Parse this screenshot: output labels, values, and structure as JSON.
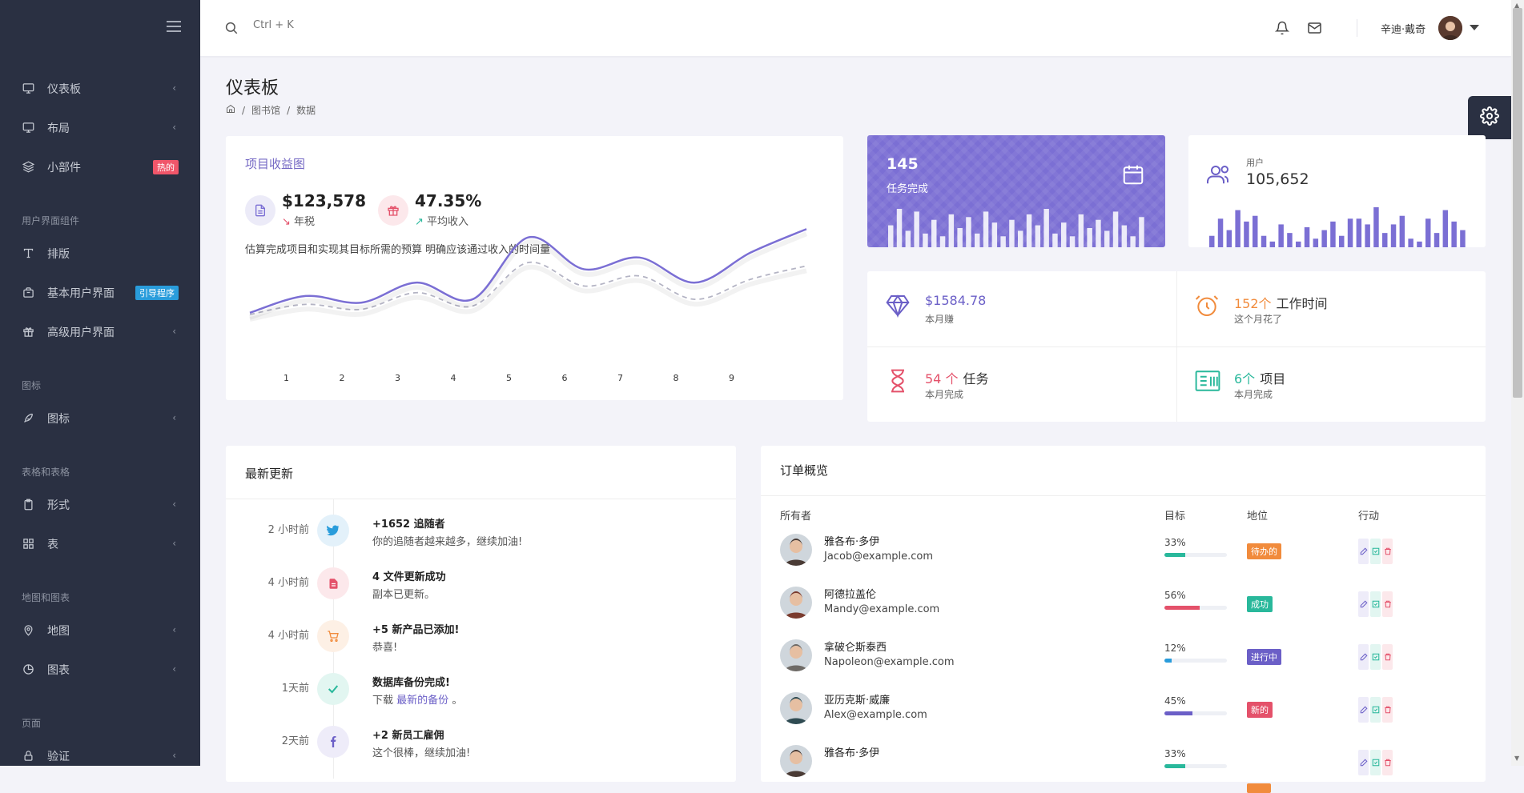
{
  "search": {
    "placeholder": "Ctrl + K"
  },
  "user": {
    "name": "辛迪·戴奇"
  },
  "sidebar": {
    "items": [
      {
        "label": "仪表板",
        "icon": "monitor-icon"
      },
      {
        "label": "布局",
        "icon": "monitor-icon"
      },
      {
        "label": "小部件",
        "icon": "layers-icon",
        "badge": "热的",
        "badge_color": "#f0566a"
      }
    ],
    "sections": [
      {
        "title": "用户界面组件",
        "items": [
          {
            "label": "排版",
            "icon": "type-icon"
          },
          {
            "label": "基本用户界面",
            "icon": "briefcase-icon",
            "badge": "引导程序",
            "badge_color": "#299cdb"
          },
          {
            "label": "高级用户界面",
            "icon": "gift-icon"
          }
        ]
      },
      {
        "title": "图标",
        "items": [
          {
            "label": "图标",
            "icon": "feather-icon"
          }
        ]
      },
      {
        "title": "表格和表格",
        "items": [
          {
            "label": "形式",
            "icon": "clipboard-icon"
          },
          {
            "label": "表",
            "icon": "grid-icon"
          }
        ]
      },
      {
        "title": "地图和图表",
        "items": [
          {
            "label": "地图",
            "icon": "map-pin-icon"
          },
          {
            "label": "图表",
            "icon": "pie-chart-icon"
          }
        ]
      },
      {
        "title": "页面",
        "items": [
          {
            "label": "验证",
            "icon": "lock-icon"
          }
        ]
      }
    ]
  },
  "page": {
    "title": "仪表板",
    "breadcrumb": [
      "图书馆",
      "数据"
    ]
  },
  "project": {
    "title": "项目收益图",
    "stat1": {
      "value": "$123,578",
      "label": "年税"
    },
    "stat2": {
      "value": "47.35%",
      "label": "平均收入"
    },
    "desc": "估算完成项目和实现其目标所需的预算 明确应该通过收入的时间量"
  },
  "chart_data": {
    "type": "line",
    "x": [
      0,
      1,
      2,
      3,
      4,
      5,
      6,
      7,
      8,
      9,
      10
    ],
    "tick_labels": [
      "1",
      "2",
      "3",
      "4",
      "5",
      "6",
      "7",
      "8",
      "9"
    ],
    "series": [
      {
        "values": [
          2,
          12,
          8,
          20,
          10,
          47,
          28,
          35,
          20,
          38,
          52
        ],
        "color": "#7b6fd4"
      },
      {
        "values": [
          1,
          7,
          4,
          14,
          6,
          32,
          18,
          24,
          10,
          22,
          30
        ],
        "color": "#b4b4c4",
        "dashed": true
      }
    ],
    "ylim": [
      0,
      55
    ]
  },
  "tasks": {
    "count": "145",
    "label": "任务完成",
    "bars": [
      8,
      14,
      6,
      13,
      5,
      10,
      4,
      12,
      7,
      11,
      5,
      13,
      9,
      4,
      10,
      6,
      12,
      8,
      14,
      5,
      9,
      4,
      12,
      7,
      10,
      6,
      13,
      8,
      4,
      11
    ]
  },
  "users": {
    "label": "用户",
    "count": "105,652",
    "bars": [
      4,
      10,
      6,
      13,
      9,
      11,
      4,
      2,
      8,
      5,
      2,
      7,
      3,
      6,
      9,
      4,
      10,
      10,
      8,
      14,
      5,
      8,
      11,
      3,
      2,
      10,
      5,
      13,
      9,
      6
    ]
  },
  "metrics": [
    {
      "value": "$1584.78",
      "suffix": "",
      "sub": "本月赚",
      "color": "#6b5fc7",
      "icon": "diamond-icon"
    },
    {
      "value": "152个",
      "suffix": "工作时间",
      "sub": "这个月花了",
      "color": "#f18b3c",
      "icon": "alarm-clock-icon"
    },
    {
      "value": "54 个",
      "suffix": "任务",
      "sub": "本月完成",
      "color": "#e4516a",
      "icon": "hourglass-icon"
    },
    {
      "value": "6个",
      "suffix": "项目",
      "sub": "本月完成",
      "color": "#29b89b",
      "icon": "invoice-icon"
    }
  ],
  "updates": {
    "title": "最新更新",
    "items": [
      {
        "time": "2 小时前",
        "title": "+1652 追随者",
        "body": "你的追随者越来越多，继续加油!",
        "icon": "twitter-icon",
        "color": "#299cdb",
        "bg": "#e3f1fa"
      },
      {
        "time": "4 小时前",
        "title": "4 文件更新成功",
        "body": "副本已更新。",
        "icon": "file-icon",
        "color": "#e4516a",
        "bg": "#fce8eb"
      },
      {
        "time": "4 小时前",
        "title": "+5 新产品已添加!",
        "body": "恭喜!",
        "icon": "cart-icon",
        "color": "#f18b3c",
        "bg": "#fdf0e5"
      },
      {
        "time": "1天前",
        "title": "数据库备份完成!",
        "body": "下载",
        "link": "最新的备份",
        "tail": "。",
        "icon": "check-icon",
        "color": "#29b89b",
        "bg": "#e2f6f1"
      },
      {
        "time": "2天前",
        "title": "+2 新员工雇佣",
        "body": "这个很棒，继续加油!",
        "icon": "facebook-icon",
        "color": "#6b5fc7",
        "bg": "#eeecf9"
      }
    ]
  },
  "orders": {
    "title": "订单概览",
    "headers": {
      "owner": "所有者",
      "target": "目标",
      "status": "地位",
      "action": "行动"
    },
    "rows": [
      {
        "name": "雅各布·多伊",
        "email": "Jacob@example.com",
        "pct": "33%",
        "progress": 0.33,
        "bar_color": "#29b89b",
        "status": "待办的",
        "status_color": "#f18b3c"
      },
      {
        "name": "阿德拉盖伦",
        "email": "Mandy@example.com",
        "pct": "56%",
        "progress": 0.56,
        "bar_color": "#e4516a",
        "status": "成功",
        "status_color": "#29b89b"
      },
      {
        "name": "拿破仑斯泰西",
        "email": "Napoleon@example.com",
        "pct": "12%",
        "progress": 0.12,
        "bar_color": "#299cdb",
        "status": "进行中",
        "status_color": "#6b5fc7"
      },
      {
        "name": "亚历克斯·威廉",
        "email": "Alex@example.com",
        "pct": "45%",
        "progress": 0.45,
        "bar_color": "#6b5fc7",
        "status": "新的",
        "status_color": "#e4516a"
      },
      {
        "name": "雅各布·多伊",
        "email": "",
        "pct": "33%",
        "progress": 0.33,
        "bar_color": "#29b89b",
        "status": "",
        "status_color": "#f18b3c"
      }
    ]
  }
}
